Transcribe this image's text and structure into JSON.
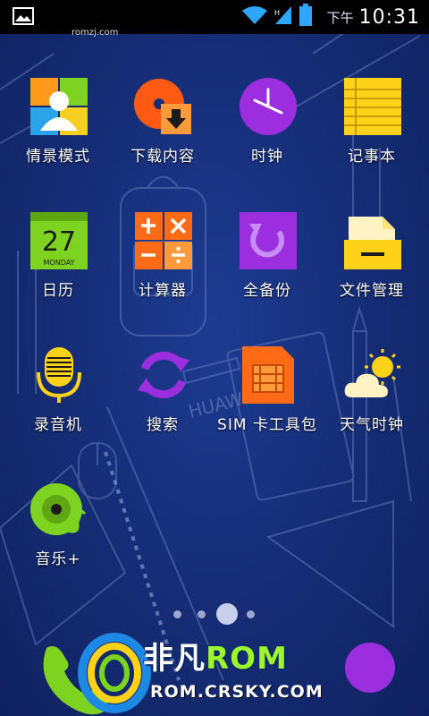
{
  "status_bar": {
    "am_pm": "下午",
    "time": "10:31",
    "icons": [
      "image-icon",
      "wifi-icon",
      "signal-icon",
      "battery-icon"
    ]
  },
  "watermark": "romzj.com",
  "apps": [
    {
      "label": "情景模式",
      "icon": "profiles-icon"
    },
    {
      "label": "下载内容",
      "icon": "downloads-icon"
    },
    {
      "label": "时钟",
      "icon": "clock-icon"
    },
    {
      "label": "记事本",
      "icon": "notepad-icon"
    },
    {
      "label": "日历",
      "icon": "calendar-icon",
      "day": "27",
      "month": "MONDAY"
    },
    {
      "label": "计算器",
      "icon": "calculator-icon"
    },
    {
      "label": "全备份",
      "icon": "backup-icon"
    },
    {
      "label": "文件管理",
      "icon": "file-manager-icon"
    },
    {
      "label": "录音机",
      "icon": "recorder-icon"
    },
    {
      "label": "搜索",
      "icon": "search-icon"
    },
    {
      "label": "SIM 卡工具包",
      "icon": "sim-toolkit-icon"
    },
    {
      "label": "天气时钟",
      "icon": "weather-clock-icon"
    },
    {
      "label": "音乐+",
      "icon": "music-icon"
    }
  ],
  "wallpaper_text": "HUAWEI",
  "page_indicator": {
    "pages": 4,
    "current": 3
  },
  "overlay_logo": {
    "brand_left": "非凡",
    "brand_right": "ROM",
    "url": "ROM.CRSKY.COM"
  },
  "colors": {
    "background": "#152c74",
    "status_bar": "#000000",
    "brand_green": "#9df52b"
  }
}
